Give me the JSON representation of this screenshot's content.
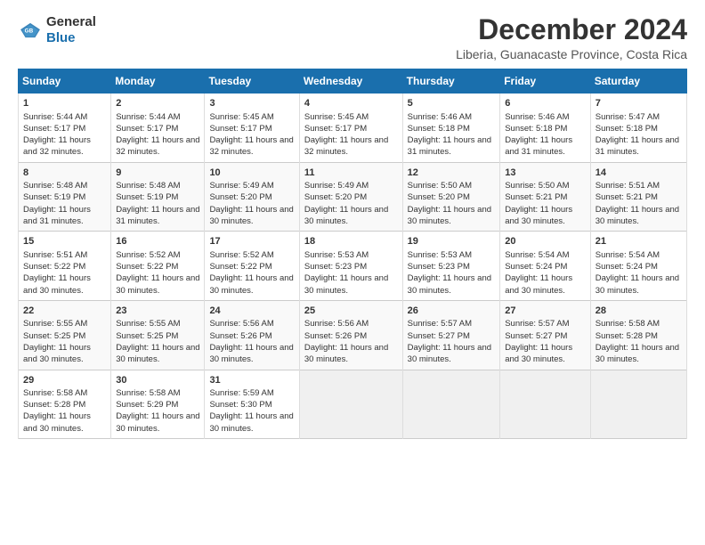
{
  "logo": {
    "general": "General",
    "blue": "Blue"
  },
  "title": "December 2024",
  "subtitle": "Liberia, Guanacaste Province, Costa Rica",
  "days_header": [
    "Sunday",
    "Monday",
    "Tuesday",
    "Wednesday",
    "Thursday",
    "Friday",
    "Saturday"
  ],
  "weeks": [
    [
      {
        "day": "1",
        "sunrise": "Sunrise: 5:44 AM",
        "sunset": "Sunset: 5:17 PM",
        "daylight": "Daylight: 11 hours and 32 minutes."
      },
      {
        "day": "2",
        "sunrise": "Sunrise: 5:44 AM",
        "sunset": "Sunset: 5:17 PM",
        "daylight": "Daylight: 11 hours and 32 minutes."
      },
      {
        "day": "3",
        "sunrise": "Sunrise: 5:45 AM",
        "sunset": "Sunset: 5:17 PM",
        "daylight": "Daylight: 11 hours and 32 minutes."
      },
      {
        "day": "4",
        "sunrise": "Sunrise: 5:45 AM",
        "sunset": "Sunset: 5:17 PM",
        "daylight": "Daylight: 11 hours and 32 minutes."
      },
      {
        "day": "5",
        "sunrise": "Sunrise: 5:46 AM",
        "sunset": "Sunset: 5:18 PM",
        "daylight": "Daylight: 11 hours and 31 minutes."
      },
      {
        "day": "6",
        "sunrise": "Sunrise: 5:46 AM",
        "sunset": "Sunset: 5:18 PM",
        "daylight": "Daylight: 11 hours and 31 minutes."
      },
      {
        "day": "7",
        "sunrise": "Sunrise: 5:47 AM",
        "sunset": "Sunset: 5:18 PM",
        "daylight": "Daylight: 11 hours and 31 minutes."
      }
    ],
    [
      {
        "day": "8",
        "sunrise": "Sunrise: 5:48 AM",
        "sunset": "Sunset: 5:19 PM",
        "daylight": "Daylight: 11 hours and 31 minutes."
      },
      {
        "day": "9",
        "sunrise": "Sunrise: 5:48 AM",
        "sunset": "Sunset: 5:19 PM",
        "daylight": "Daylight: 11 hours and 31 minutes."
      },
      {
        "day": "10",
        "sunrise": "Sunrise: 5:49 AM",
        "sunset": "Sunset: 5:20 PM",
        "daylight": "Daylight: 11 hours and 30 minutes."
      },
      {
        "day": "11",
        "sunrise": "Sunrise: 5:49 AM",
        "sunset": "Sunset: 5:20 PM",
        "daylight": "Daylight: 11 hours and 30 minutes."
      },
      {
        "day": "12",
        "sunrise": "Sunrise: 5:50 AM",
        "sunset": "Sunset: 5:20 PM",
        "daylight": "Daylight: 11 hours and 30 minutes."
      },
      {
        "day": "13",
        "sunrise": "Sunrise: 5:50 AM",
        "sunset": "Sunset: 5:21 PM",
        "daylight": "Daylight: 11 hours and 30 minutes."
      },
      {
        "day": "14",
        "sunrise": "Sunrise: 5:51 AM",
        "sunset": "Sunset: 5:21 PM",
        "daylight": "Daylight: 11 hours and 30 minutes."
      }
    ],
    [
      {
        "day": "15",
        "sunrise": "Sunrise: 5:51 AM",
        "sunset": "Sunset: 5:22 PM",
        "daylight": "Daylight: 11 hours and 30 minutes."
      },
      {
        "day": "16",
        "sunrise": "Sunrise: 5:52 AM",
        "sunset": "Sunset: 5:22 PM",
        "daylight": "Daylight: 11 hours and 30 minutes."
      },
      {
        "day": "17",
        "sunrise": "Sunrise: 5:52 AM",
        "sunset": "Sunset: 5:22 PM",
        "daylight": "Daylight: 11 hours and 30 minutes."
      },
      {
        "day": "18",
        "sunrise": "Sunrise: 5:53 AM",
        "sunset": "Sunset: 5:23 PM",
        "daylight": "Daylight: 11 hours and 30 minutes."
      },
      {
        "day": "19",
        "sunrise": "Sunrise: 5:53 AM",
        "sunset": "Sunset: 5:23 PM",
        "daylight": "Daylight: 11 hours and 30 minutes."
      },
      {
        "day": "20",
        "sunrise": "Sunrise: 5:54 AM",
        "sunset": "Sunset: 5:24 PM",
        "daylight": "Daylight: 11 hours and 30 minutes."
      },
      {
        "day": "21",
        "sunrise": "Sunrise: 5:54 AM",
        "sunset": "Sunset: 5:24 PM",
        "daylight": "Daylight: 11 hours and 30 minutes."
      }
    ],
    [
      {
        "day": "22",
        "sunrise": "Sunrise: 5:55 AM",
        "sunset": "Sunset: 5:25 PM",
        "daylight": "Daylight: 11 hours and 30 minutes."
      },
      {
        "day": "23",
        "sunrise": "Sunrise: 5:55 AM",
        "sunset": "Sunset: 5:25 PM",
        "daylight": "Daylight: 11 hours and 30 minutes."
      },
      {
        "day": "24",
        "sunrise": "Sunrise: 5:56 AM",
        "sunset": "Sunset: 5:26 PM",
        "daylight": "Daylight: 11 hours and 30 minutes."
      },
      {
        "day": "25",
        "sunrise": "Sunrise: 5:56 AM",
        "sunset": "Sunset: 5:26 PM",
        "daylight": "Daylight: 11 hours and 30 minutes."
      },
      {
        "day": "26",
        "sunrise": "Sunrise: 5:57 AM",
        "sunset": "Sunset: 5:27 PM",
        "daylight": "Daylight: 11 hours and 30 minutes."
      },
      {
        "day": "27",
        "sunrise": "Sunrise: 5:57 AM",
        "sunset": "Sunset: 5:27 PM",
        "daylight": "Daylight: 11 hours and 30 minutes."
      },
      {
        "day": "28",
        "sunrise": "Sunrise: 5:58 AM",
        "sunset": "Sunset: 5:28 PM",
        "daylight": "Daylight: 11 hours and 30 minutes."
      }
    ],
    [
      {
        "day": "29",
        "sunrise": "Sunrise: 5:58 AM",
        "sunset": "Sunset: 5:28 PM",
        "daylight": "Daylight: 11 hours and 30 minutes."
      },
      {
        "day": "30",
        "sunrise": "Sunrise: 5:58 AM",
        "sunset": "Sunset: 5:29 PM",
        "daylight": "Daylight: 11 hours and 30 minutes."
      },
      {
        "day": "31",
        "sunrise": "Sunrise: 5:59 AM",
        "sunset": "Sunset: 5:30 PM",
        "daylight": "Daylight: 11 hours and 30 minutes."
      },
      null,
      null,
      null,
      null
    ]
  ]
}
